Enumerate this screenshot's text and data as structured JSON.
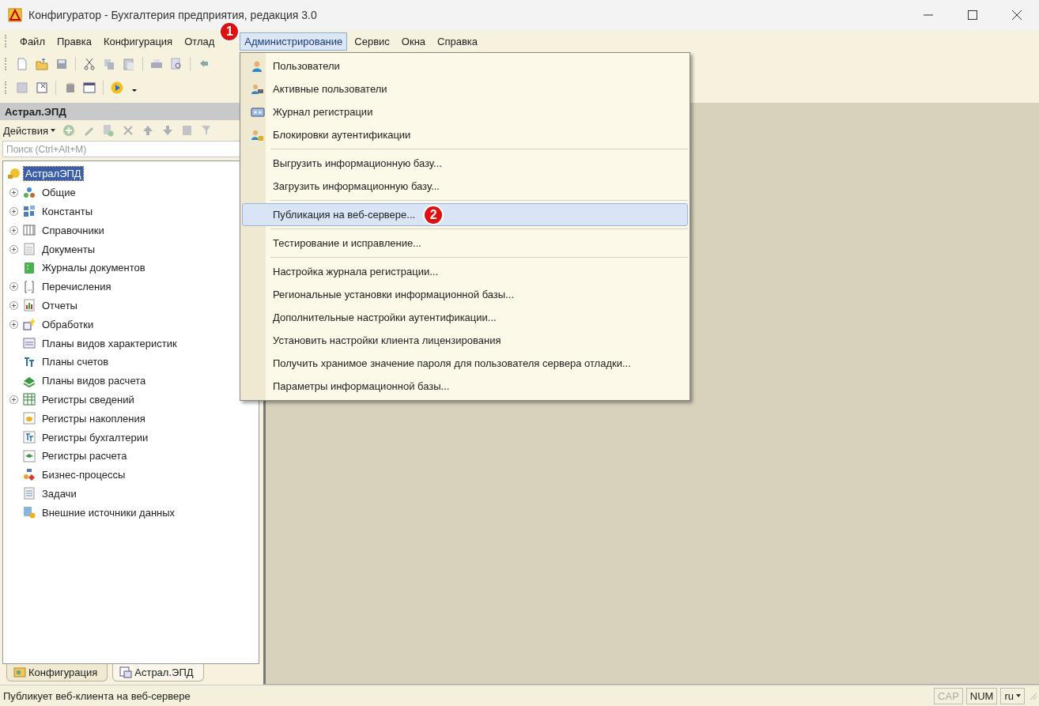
{
  "window": {
    "title": "Конфигуратор - Бухгалтерия предприятия, редакция 3.0"
  },
  "menubar": [
    {
      "label": "Файл",
      "selected": false
    },
    {
      "label": "Правка",
      "selected": false
    },
    {
      "label": "Конфигурация",
      "selected": false
    },
    {
      "label": "Отлад",
      "selected": false,
      "badge": "1"
    },
    {
      "label": "Администрирование",
      "selected": true
    },
    {
      "label": "Сервис",
      "selected": false
    },
    {
      "label": "Окна",
      "selected": false
    },
    {
      "label": "Справка",
      "selected": false
    }
  ],
  "menu": {
    "sections": [
      [
        {
          "label": "Пользователи",
          "kind": "user",
          "selected": false
        },
        {
          "label": "Активные пользователи",
          "kind": "user-monitor",
          "selected": false
        },
        {
          "label": "Журнал регистрации",
          "kind": "journal",
          "selected": false
        },
        {
          "label": "Блокировки аутентификации",
          "kind": "user-lock",
          "selected": false
        }
      ],
      [
        {
          "label": "Выгрузить информационную базу...",
          "kind": "plain",
          "selected": false
        },
        {
          "label": "Загрузить информационную базу...",
          "kind": "plain",
          "selected": false
        }
      ],
      [
        {
          "label": "Публикация на веб-сервере...",
          "kind": "plain",
          "selected": true,
          "badge": "2"
        }
      ],
      [
        {
          "label": "Тестирование и исправление...",
          "kind": "plain",
          "selected": false
        }
      ],
      [
        {
          "label": "Настройка журнала регистрации...",
          "kind": "plain",
          "selected": false
        },
        {
          "label": "Региональные установки информационной базы...",
          "kind": "plain",
          "selected": false
        },
        {
          "label": "Дополнительные настройки аутентификации...",
          "kind": "plain",
          "selected": false
        },
        {
          "label": "Установить настройки клиента лицензирования",
          "kind": "plain",
          "selected": false
        },
        {
          "label": "Получить хранимое значение пароля для пользователя сервера отладки...",
          "kind": "plain",
          "selected": false
        },
        {
          "label": "Параметры информационной базы...",
          "kind": "plain",
          "selected": false
        }
      ]
    ]
  },
  "panel": {
    "title": "Астрал.ЭПД",
    "actions": "Действия",
    "search": {
      "placeholder": "Поиск (Ctrl+Alt+M)"
    }
  },
  "tree": {
    "root": {
      "label": "АстралЭПД",
      "selected": true
    },
    "children": [
      {
        "label": "Общие",
        "kind": "common",
        "collapsed": true
      },
      {
        "label": "Константы",
        "kind": "constants",
        "collapsed": true
      },
      {
        "label": "Справочники",
        "kind": "catalogs",
        "collapsed": true
      },
      {
        "label": "Документы",
        "kind": "documents",
        "collapsed": true
      },
      {
        "label": "Журналы документов",
        "kind": "journals",
        "collapsed": false
      },
      {
        "label": "Перечисления",
        "kind": "enums",
        "collapsed": true
      },
      {
        "label": "Отчеты",
        "kind": "reports",
        "collapsed": true
      },
      {
        "label": "Обработки",
        "kind": "processors",
        "collapsed": true
      },
      {
        "label": "Планы видов характеристик",
        "kind": "chars",
        "collapsed": false
      },
      {
        "label": "Планы счетов",
        "kind": "accounts",
        "collapsed": false
      },
      {
        "label": "Планы видов расчета",
        "kind": "calc-types",
        "collapsed": false
      },
      {
        "label": "Регистры сведений",
        "kind": "info-reg",
        "collapsed": true
      },
      {
        "label": "Регистры накопления",
        "kind": "accum-reg",
        "collapsed": false
      },
      {
        "label": "Регистры бухгалтерии",
        "kind": "acc-reg",
        "collapsed": false
      },
      {
        "label": "Регистры расчета",
        "kind": "calc-reg",
        "collapsed": false
      },
      {
        "label": "Бизнес-процессы",
        "kind": "bp",
        "collapsed": false
      },
      {
        "label": "Задачи",
        "kind": "tasks",
        "collapsed": false
      },
      {
        "label": "Внешние источники данных",
        "kind": "ext",
        "collapsed": false
      }
    ]
  },
  "bottom_tabs": [
    {
      "label": "Конфигурация",
      "selected": true,
      "kind": "config"
    },
    {
      "label": "Астрал.ЭПД",
      "selected": false,
      "kind": "subsystem"
    }
  ],
  "status_bar": {
    "text": "Публикует веб-клиента на веб-сервере",
    "indicators": [
      {
        "label": "CAP",
        "on": false
      },
      {
        "label": "NUM",
        "on": true
      }
    ],
    "language": "ru"
  }
}
